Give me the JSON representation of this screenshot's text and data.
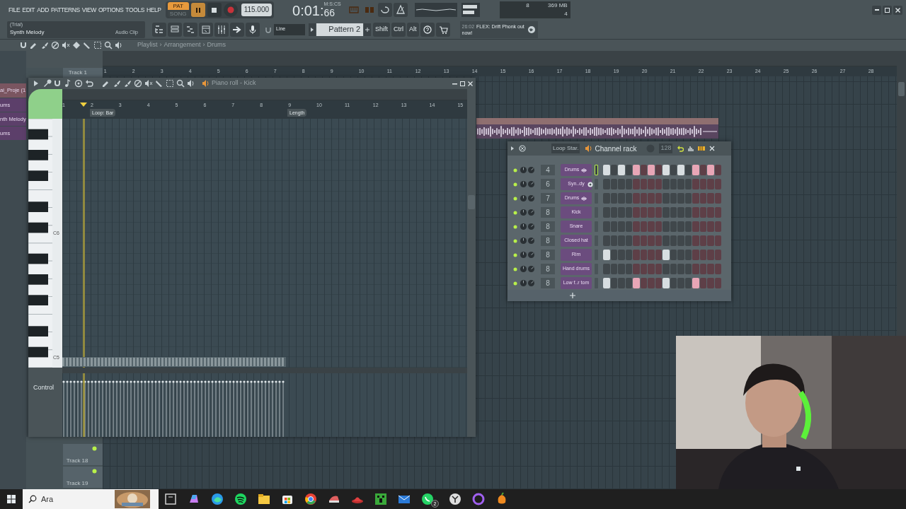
{
  "menu": [
    "FILE",
    "EDIT",
    "ADD",
    "PATTERNS",
    "VIEW",
    "OPTIONS",
    "TOOLS",
    "HELP"
  ],
  "transport": {
    "modes": [
      {
        "label": "PAT",
        "selected": true
      },
      {
        "label": "SONG",
        "selected": false
      }
    ],
    "playing": true,
    "recording": false,
    "tempo": "115.000",
    "time": "0:01:",
    "time_cs": "66",
    "time_unit": "M:S:CS"
  },
  "hint": {
    "line1": "(Trial)",
    "line2": "Synth Melody",
    "source": "Audio Clip"
  },
  "snap": "Line",
  "pattern": "Pattern 2",
  "modifiers": [
    "Shift",
    "Ctrl",
    "Alt"
  ],
  "cpu": {
    "polyphony": "8",
    "memory": "369 MB",
    "cpu": "4"
  },
  "news": {
    "time": "26:02",
    "text": "FLEX: Drift Phonk out now!"
  },
  "playlist": {
    "breadcrumb": [
      "Playlist",
      "Arrangement",
      "Drums"
    ],
    "breadcrumb_separator": "›",
    "bars": [
      "1",
      "2",
      "3",
      "4",
      "5",
      "6",
      "7",
      "8",
      "9",
      "10",
      "11",
      "12",
      "13",
      "14",
      "15",
      "16",
      "17",
      "18",
      "19",
      "20",
      "21",
      "22",
      "23",
      "24",
      "25",
      "26",
      "27",
      "28"
    ],
    "picker": [
      "ai_Proje (1",
      "ums",
      "nth Melody",
      "ums"
    ],
    "tracks": [
      "Track 1",
      "Track 18",
      "Track 19"
    ]
  },
  "piano_roll": {
    "title": "Piano roll - Kick",
    "bars": [
      "1",
      "2",
      "3",
      "4",
      "5",
      "6",
      "7",
      "8",
      "9",
      "10",
      "11",
      "12",
      "13",
      "14",
      "15"
    ],
    "loop_marker": "Loop: Bar",
    "length_marker": "Length",
    "keys": [
      "C6",
      "C5"
    ],
    "control": "Control"
  },
  "channel_rack": {
    "loop_label": "Loop Star.",
    "title": "Channel rack",
    "swing": "128",
    "channels": [
      {
        "number": "4",
        "name": "Drums",
        "kind": "layer",
        "selected": true,
        "steps": [
          true,
          false,
          true,
          false,
          true,
          false,
          true,
          false,
          true,
          false,
          true,
          false,
          true,
          false,
          true,
          false
        ]
      },
      {
        "number": "6",
        "name": "Syn..dy",
        "kind": "sampler",
        "selected": false,
        "steps": [
          false,
          false,
          false,
          false,
          false,
          false,
          false,
          false,
          false,
          false,
          false,
          false,
          false,
          false,
          false,
          false
        ]
      },
      {
        "number": "7",
        "name": "Drums",
        "kind": "layer",
        "selected": false,
        "steps": [
          false,
          false,
          false,
          false,
          false,
          false,
          false,
          false,
          false,
          false,
          false,
          false,
          false,
          false,
          false,
          false
        ]
      },
      {
        "number": "8",
        "name": "Kick",
        "kind": "sampler",
        "selected": false,
        "steps": [
          false,
          false,
          false,
          false,
          false,
          false,
          false,
          false,
          false,
          false,
          false,
          false,
          false,
          false,
          false,
          false
        ]
      },
      {
        "number": "8",
        "name": "Snare",
        "kind": "sampler",
        "selected": false,
        "steps": [
          false,
          false,
          false,
          false,
          false,
          false,
          false,
          false,
          false,
          false,
          false,
          false,
          false,
          false,
          false,
          false
        ]
      },
      {
        "number": "8",
        "name": "Closed hat",
        "kind": "sampler",
        "selected": false,
        "steps": [
          false,
          false,
          false,
          false,
          false,
          false,
          false,
          false,
          false,
          false,
          false,
          false,
          false,
          false,
          false,
          false
        ]
      },
      {
        "number": "8",
        "name": "Rim",
        "kind": "sampler",
        "selected": false,
        "steps": [
          true,
          false,
          false,
          false,
          false,
          false,
          false,
          false,
          true,
          false,
          false,
          false,
          false,
          false,
          false,
          false
        ]
      },
      {
        "number": "8",
        "name": "Hand drums",
        "kind": "sampler",
        "selected": false,
        "steps": [
          false,
          false,
          false,
          false,
          false,
          false,
          false,
          false,
          false,
          false,
          false,
          false,
          false,
          false,
          false,
          false
        ]
      },
      {
        "number": "8",
        "name": "Low f..r tom",
        "kind": "sampler",
        "selected": false,
        "steps": [
          true,
          false,
          false,
          false,
          true,
          false,
          false,
          false,
          true,
          false,
          false,
          false,
          true,
          false,
          false,
          false
        ]
      }
    ]
  },
  "taskbar": {
    "search_placeholder": "Ara",
    "badge": "2"
  }
}
